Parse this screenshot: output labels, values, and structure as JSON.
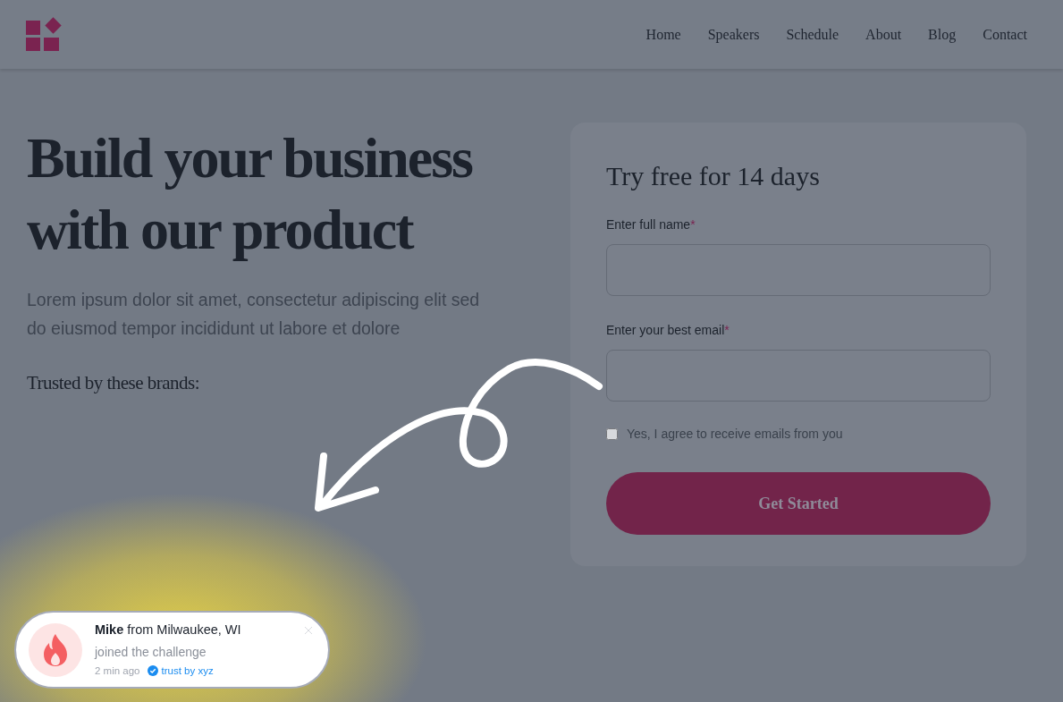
{
  "nav": {
    "items": [
      "Home",
      "Speakers",
      "Schedule",
      "About",
      "Blog",
      "Contact"
    ]
  },
  "hero": {
    "title_lines": [
      "Build your business",
      "with our product"
    ],
    "description": "Lorem ipsum dolor sit amet, consectetur adipiscing elit sed do eiusmod tempor incididunt ut labore et dolore",
    "brands_label": "Trusted by these brands:"
  },
  "form": {
    "title": "Try free for 14 days",
    "fields": [
      {
        "label": "Enter full name",
        "required_mark": "*"
      },
      {
        "label": "Enter your best email",
        "required_mark": "*"
      }
    ],
    "consent": {
      "label": "Yes, I agree to receive emails from you",
      "checked": false
    },
    "submit": "Get Started"
  },
  "notification": {
    "headline": "**Mike** from Milwaukee, WI",
    "message": "joined the challenge",
    "time": "2 min ago",
    "badge": "trust by xyz"
  }
}
